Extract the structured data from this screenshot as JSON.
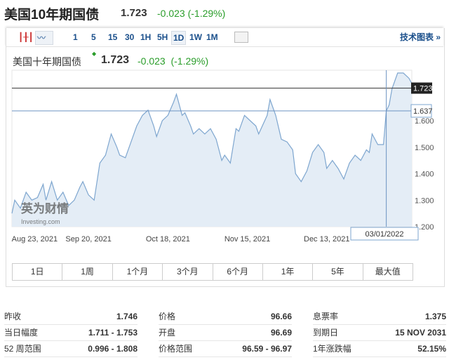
{
  "header": {
    "title": "美国10年期国债",
    "price": "1.723",
    "change": "-0.023 (-1.29%)"
  },
  "toolbar": {
    "intervals": [
      "1",
      "5",
      "15",
      "30",
      "1H",
      "5H",
      "1D",
      "1W",
      "1M"
    ],
    "selected": "1D",
    "tech_chart": "技术图表 »"
  },
  "chart_header": {
    "name": "美国十年期国债",
    "price": "1.723",
    "change": "-0.023",
    "change_pct": "(-1.29%)"
  },
  "watermark": "英为财情 Investing.com",
  "chart_data": {
    "type": "area",
    "ylim": [
      1.2,
      1.8
    ],
    "yticks": [
      "1.200",
      "1.300",
      "1.400",
      "1.500",
      "1.600"
    ],
    "ytick_values": [
      1.2,
      1.3,
      1.4,
      1.5,
      1.6
    ],
    "xlim": [
      0,
      141
    ],
    "xticks": [
      {
        "label": "Aug 23, 2021",
        "day": 8
      },
      {
        "label": "Sep 20, 2021",
        "day": 27
      },
      {
        "label": "Oct 18, 2021",
        "day": 55
      },
      {
        "label": "Nov 15, 2021",
        "day": 83
      },
      {
        "label": "Dec 13, 2021",
        "day": 111
      }
    ],
    "last_price_label": "1.723",
    "last_price": 1.723,
    "crosshair": {
      "day": 132,
      "value": 1.637,
      "value_label": "1.637",
      "date_label": "03/01/2022"
    },
    "series": [
      [
        0,
        1.25
      ],
      [
        1,
        1.3
      ],
      [
        3,
        1.27
      ],
      [
        5,
        1.33
      ],
      [
        7,
        1.3
      ],
      [
        9,
        1.31
      ],
      [
        11,
        1.36
      ],
      [
        12,
        1.3
      ],
      [
        14,
        1.37
      ],
      [
        16,
        1.3
      ],
      [
        18,
        1.33
      ],
      [
        20,
        1.28
      ],
      [
        22,
        1.3
      ],
      [
        24,
        1.35
      ],
      [
        25,
        1.37
      ],
      [
        27,
        1.32
      ],
      [
        29,
        1.3
      ],
      [
        31,
        1.44
      ],
      [
        33,
        1.47
      ],
      [
        35,
        1.55
      ],
      [
        37,
        1.5
      ],
      [
        38,
        1.47
      ],
      [
        40,
        1.46
      ],
      [
        42,
        1.52
      ],
      [
        44,
        1.58
      ],
      [
        46,
        1.62
      ],
      [
        48,
        1.64
      ],
      [
        50,
        1.58
      ],
      [
        51,
        1.54
      ],
      [
        53,
        1.6
      ],
      [
        55,
        1.62
      ],
      [
        57,
        1.67
      ],
      [
        58,
        1.7
      ],
      [
        60,
        1.62
      ],
      [
        61,
        1.63
      ],
      [
        63,
        1.58
      ],
      [
        64,
        1.55
      ],
      [
        66,
        1.57
      ],
      [
        68,
        1.55
      ],
      [
        70,
        1.57
      ],
      [
        72,
        1.53
      ],
      [
        74,
        1.45
      ],
      [
        75,
        1.47
      ],
      [
        77,
        1.44
      ],
      [
        79,
        1.57
      ],
      [
        80,
        1.56
      ],
      [
        82,
        1.62
      ],
      [
        84,
        1.6
      ],
      [
        86,
        1.58
      ],
      [
        87,
        1.55
      ],
      [
        90,
        1.62
      ],
      [
        91,
        1.68
      ],
      [
        93,
        1.62
      ],
      [
        95,
        1.53
      ],
      [
        97,
        1.52
      ],
      [
        99,
        1.49
      ],
      [
        100,
        1.4
      ],
      [
        102,
        1.37
      ],
      [
        104,
        1.41
      ],
      [
        106,
        1.48
      ],
      [
        108,
        1.51
      ],
      [
        110,
        1.48
      ],
      [
        111,
        1.42
      ],
      [
        113,
        1.45
      ],
      [
        115,
        1.42
      ],
      [
        117,
        1.38
      ],
      [
        119,
        1.44
      ],
      [
        121,
        1.47
      ],
      [
        123,
        1.45
      ],
      [
        125,
        1.49
      ],
      [
        126,
        1.48
      ],
      [
        127,
        1.55
      ],
      [
        129,
        1.51
      ],
      [
        131,
        1.51
      ],
      [
        132,
        1.637
      ],
      [
        133,
        1.66
      ],
      [
        134,
        1.72
      ],
      [
        136,
        1.78
      ],
      [
        138,
        1.78
      ],
      [
        140,
        1.76
      ],
      [
        141,
        1.74
      ]
    ]
  },
  "ranges": [
    "1日",
    "1周",
    "1个月",
    "3个月",
    "6个月",
    "1年",
    "5年",
    "最大值"
  ],
  "stats": [
    [
      {
        "label": "昨收",
        "value": "1.746"
      },
      {
        "label": "当日幅度",
        "value": "1.711 - 1.753"
      },
      {
        "label": "52 周范围",
        "value": "0.996 - 1.808"
      }
    ],
    [
      {
        "label": "价格",
        "value": "96.66"
      },
      {
        "label": "开盘",
        "value": "96.69"
      },
      {
        "label": "价格范围",
        "value": "96.59 - 96.97"
      }
    ],
    [
      {
        "label": "息票率",
        "value": "1.375"
      },
      {
        "label": "到期日",
        "value": "15 NOV 2031"
      },
      {
        "label": "1年涨跌幅",
        "value": "52.15%"
      }
    ]
  ]
}
